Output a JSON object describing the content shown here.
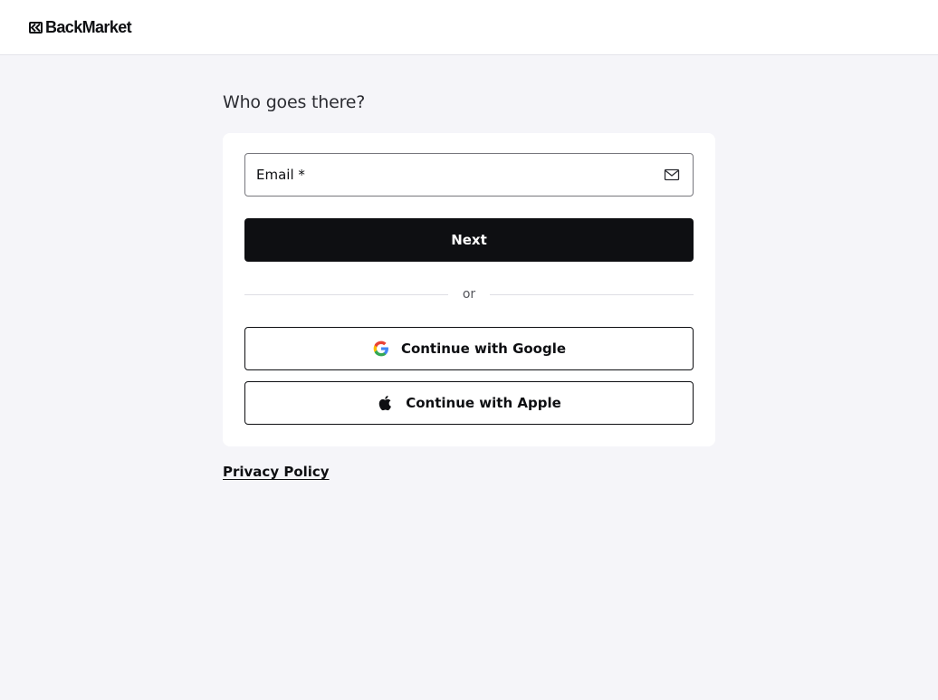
{
  "header": {
    "logo_text": "BackMarket"
  },
  "login": {
    "heading": "Who goes there?",
    "email": {
      "label": "Email *",
      "value": "",
      "icon": "envelope-icon"
    },
    "next_label": "Next",
    "divider_label": "or",
    "google_label": "Continue with Google",
    "apple_label": "Continue with Apple"
  },
  "footer": {
    "privacy_label": "Privacy Policy"
  },
  "colors": {
    "background": "#f5f5f9",
    "card": "#ffffff",
    "primary_button": "#0e0f12",
    "text": "#0e0f12"
  }
}
